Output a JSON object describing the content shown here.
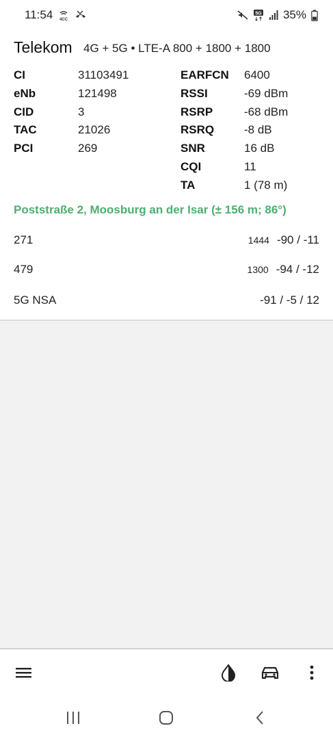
{
  "status_bar": {
    "time": "11:54",
    "battery": "35%",
    "icons_left": [
      "4cc-signal-icon",
      "missed-call-icon"
    ],
    "icons_right": [
      "mute-icon",
      "5g-data-icon",
      "signal-bars-icon",
      "battery-icon"
    ]
  },
  "operator": {
    "name": "Telekom",
    "technology": "4G + 5G • LTE-A 800 + 1800 + 1800"
  },
  "cell_info_left": [
    {
      "label": "CI",
      "value": "31103491"
    },
    {
      "label": "eNb",
      "value": "121498"
    },
    {
      "label": "CID",
      "value": "3"
    },
    {
      "label": "TAC",
      "value": "21026"
    },
    {
      "label": "PCI",
      "value": "269"
    }
  ],
  "cell_info_right": [
    {
      "label": "EARFCN",
      "value": "6400"
    },
    {
      "label": "RSSI",
      "value": "-69 dBm"
    },
    {
      "label": "RSRP",
      "value": "-68 dBm"
    },
    {
      "label": "RSRQ",
      "value": "-8 dB"
    },
    {
      "label": "SNR",
      "value": "16 dB"
    },
    {
      "label": "CQI",
      "value": "11"
    },
    {
      "label": "TA",
      "value": "1 (78 m)"
    }
  ],
  "location": "Poststraße 2, Moosburg an der Isar (± 156 m; 86°)",
  "neighbors": [
    {
      "id": "271",
      "freq": "1444",
      "signal": "-90 / -11"
    },
    {
      "id": "479",
      "freq": "1300",
      "signal": "-94 / -12"
    },
    {
      "id": "5G NSA",
      "freq": "",
      "signal": "-91 / -5 / 12"
    }
  ],
  "bottom_bar": {
    "icons": [
      "menu-icon",
      "theme-contrast-icon",
      "car-icon",
      "more-vert-icon"
    ]
  },
  "nav_bar": {
    "icons": [
      "recent-apps-icon",
      "home-icon",
      "back-icon"
    ]
  },
  "colors": {
    "location_green": "#4caf6f",
    "background": "#f2f2f2",
    "card": "#ffffff"
  }
}
